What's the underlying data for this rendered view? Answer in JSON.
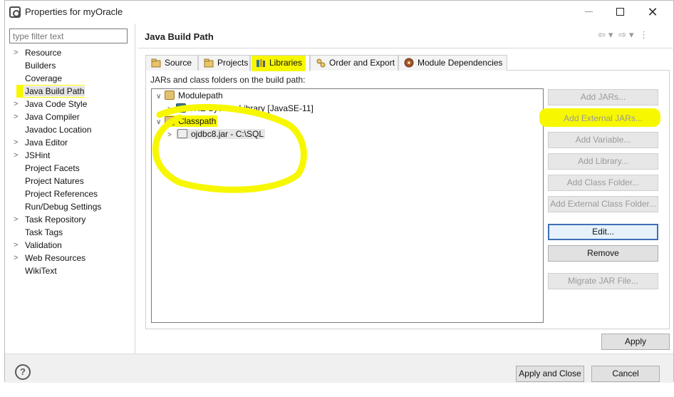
{
  "window": {
    "title": "Properties for myOracle"
  },
  "filter": {
    "placeholder": "type filter text",
    "value": ""
  },
  "nav": {
    "items": [
      {
        "label": "Resource",
        "expandable": true
      },
      {
        "label": "Builders",
        "expandable": false
      },
      {
        "label": "Coverage",
        "expandable": false
      },
      {
        "label": "Java Build Path",
        "expandable": false,
        "selected": true
      },
      {
        "label": "Java Code Style",
        "expandable": true
      },
      {
        "label": "Java Compiler",
        "expandable": true
      },
      {
        "label": "Javadoc Location",
        "expandable": false
      },
      {
        "label": "Java Editor",
        "expandable": true
      },
      {
        "label": "JSHint",
        "expandable": true
      },
      {
        "label": "Project Facets",
        "expandable": false
      },
      {
        "label": "Project Natures",
        "expandable": false
      },
      {
        "label": "Project References",
        "expandable": false
      },
      {
        "label": "Run/Debug Settings",
        "expandable": false
      },
      {
        "label": "Task Repository",
        "expandable": true
      },
      {
        "label": "Task Tags",
        "expandable": false
      },
      {
        "label": "Validation",
        "expandable": true
      },
      {
        "label": "Web Resources",
        "expandable": true
      },
      {
        "label": "WikiText",
        "expandable": false
      }
    ]
  },
  "page": {
    "title": "Java Build Path"
  },
  "tabs": [
    {
      "label": "Source"
    },
    {
      "label": "Projects"
    },
    {
      "label": "Libraries",
      "active": true
    },
    {
      "label": "Order and Export"
    },
    {
      "label": "Module Dependencies"
    }
  ],
  "libraries": {
    "section_label": "JARs and class folders on the build path:",
    "tree": {
      "modulepath": "Modulepath",
      "jre": "JRE System Library [JavaSE-11]",
      "classpath": "Classpath",
      "jar": "ojdbc8.jar - C:\\SQL"
    }
  },
  "buttons": {
    "add_jars": "Add JARs...",
    "add_external_jars": "Add External JARs...",
    "add_variable": "Add Variable...",
    "add_library": "Add Library...",
    "add_class_folder": "Add Class Folder...",
    "add_external_class_folder": "Add External Class Folder...",
    "edit": "Edit...",
    "remove": "Remove",
    "migrate_jar": "Migrate JAR File...",
    "apply": "Apply",
    "apply_and_close": "Apply and Close",
    "cancel": "Cancel"
  },
  "colors": {
    "highlight": "#f7f700",
    "focus_border": "#3f6fb5"
  }
}
